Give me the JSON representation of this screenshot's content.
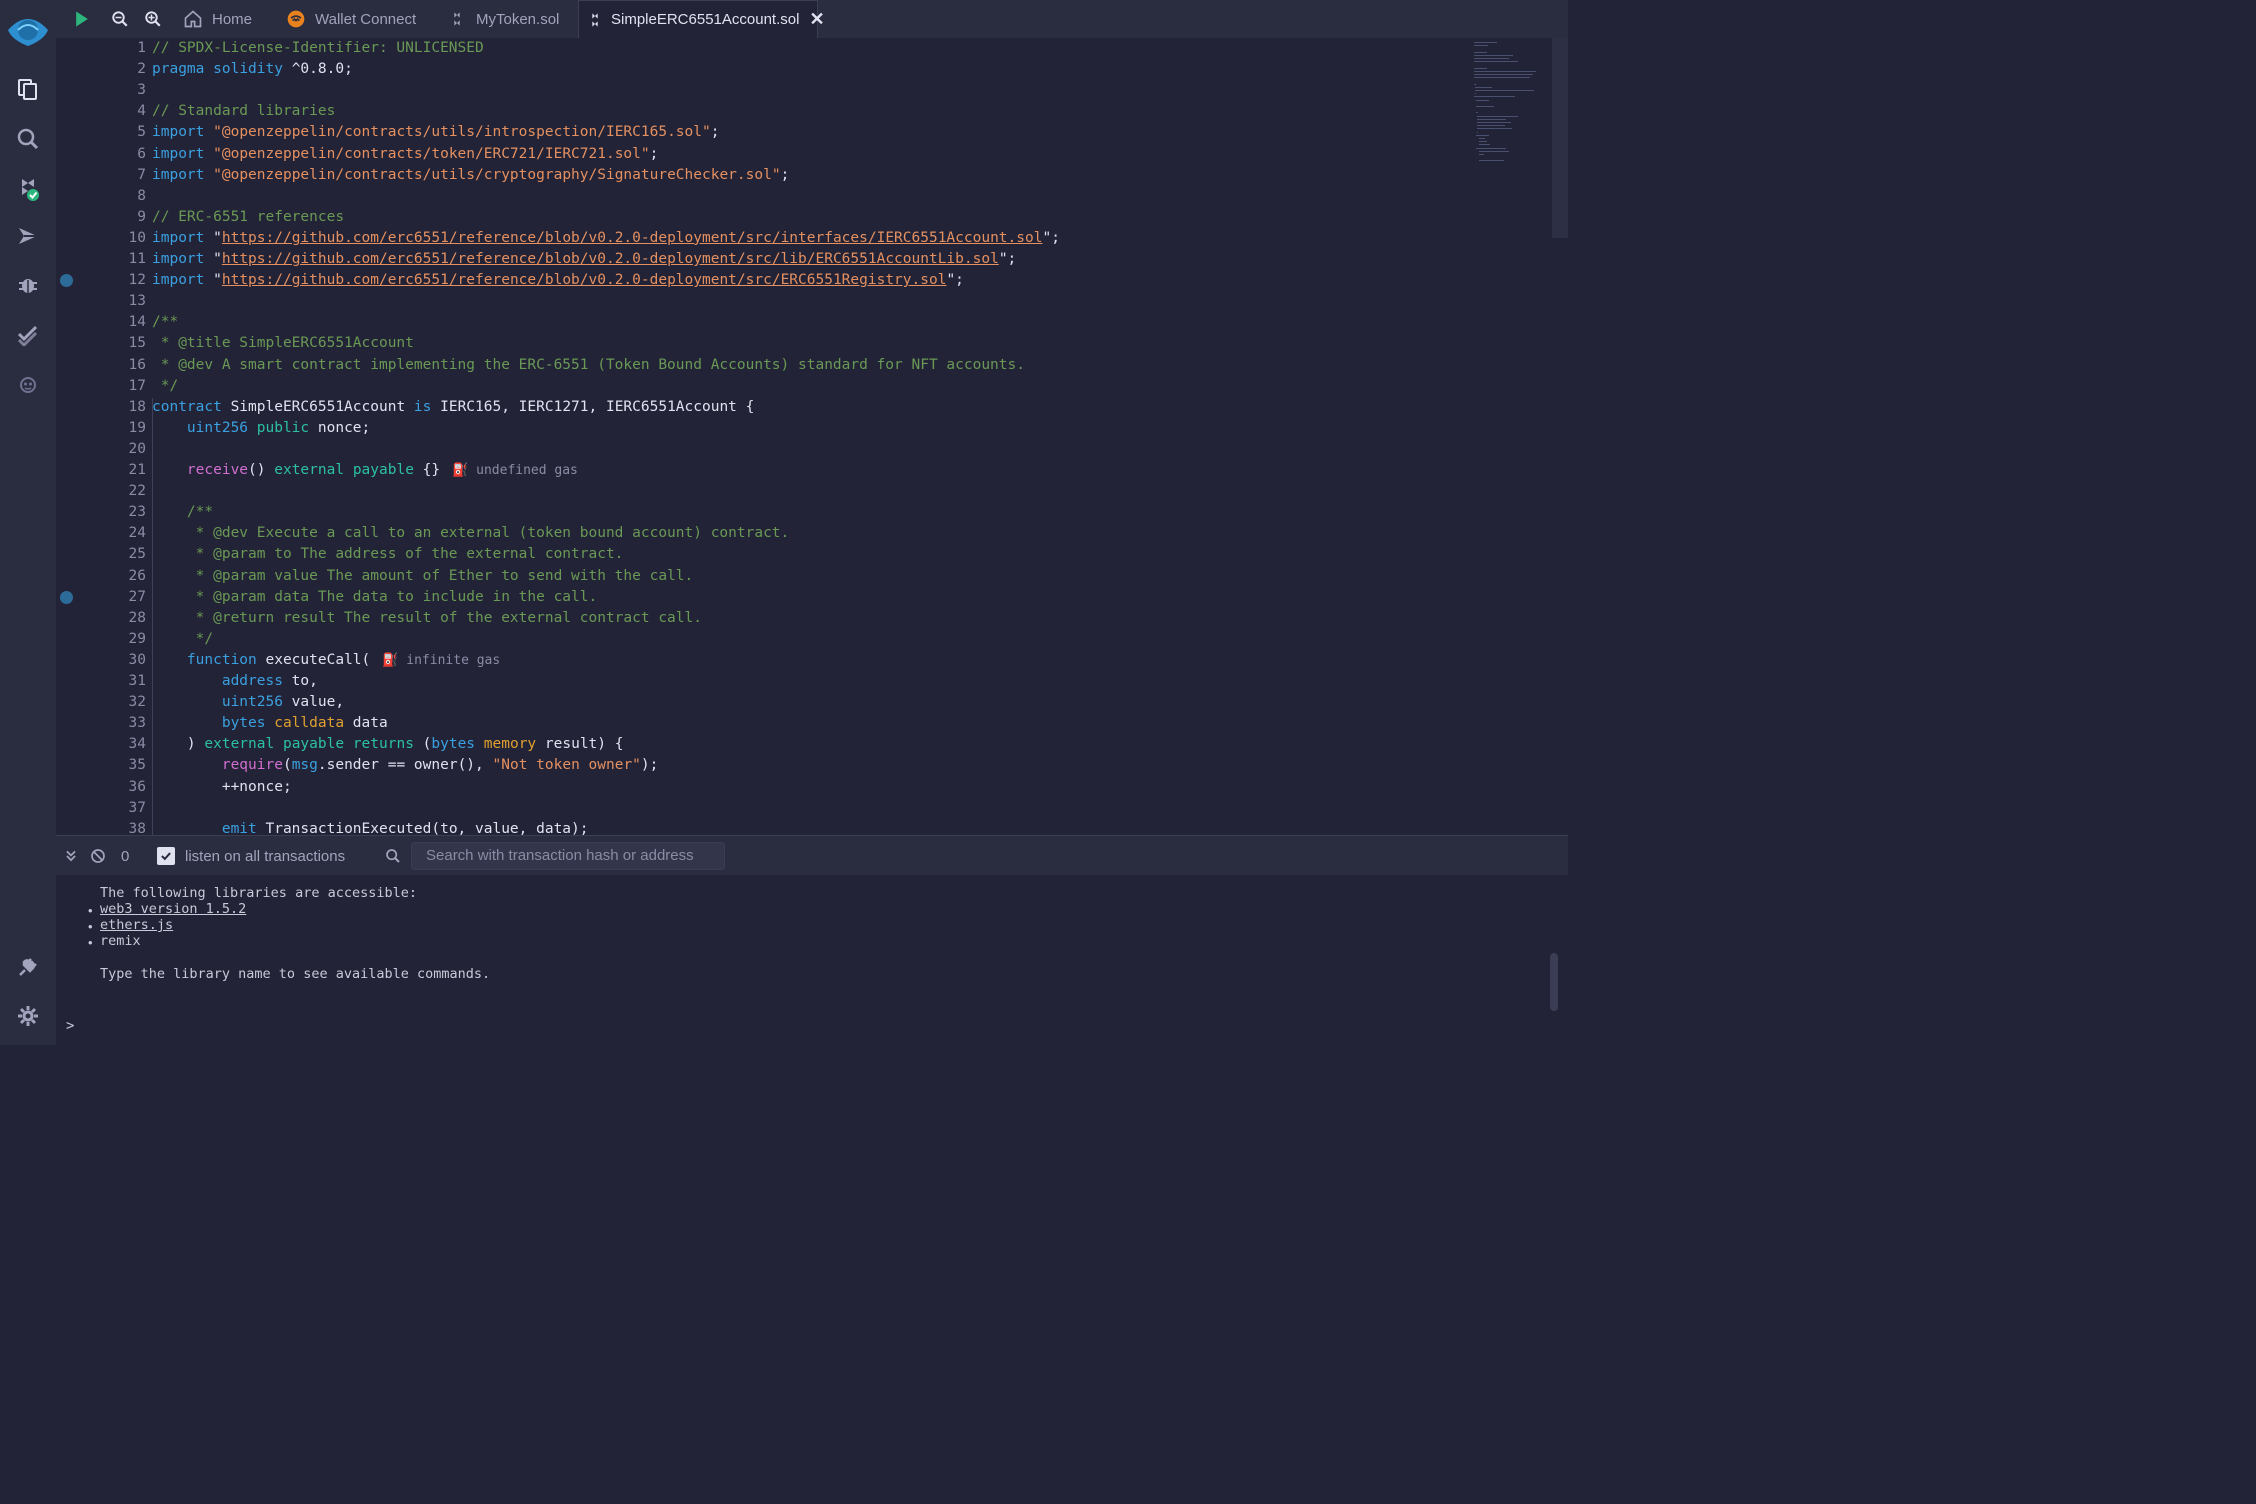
{
  "rail": {
    "icons": [
      "remix-logo-icon",
      "file-explorer-icon",
      "search-icon",
      "solidity-compiler-icon",
      "deploy-run-icon",
      "debugger-icon",
      "solidity-unit-testing-icon",
      "remixai-icon",
      "plugin-manager-icon",
      "settings-icon"
    ]
  },
  "tabbar": {
    "tabs": [
      {
        "label": "Home",
        "icon": "home-icon"
      },
      {
        "label": "Wallet Connect",
        "icon": "walletconnect-icon"
      },
      {
        "label": "MyToken.sol",
        "icon": "solidity-icon"
      },
      {
        "label": "SimpleERC6551Account.sol",
        "icon": "solidity-icon",
        "active": true
      }
    ],
    "close_label": "✕"
  },
  "editor": {
    "line_numbers": [
      "1",
      "2",
      "3",
      "4",
      "5",
      "6",
      "7",
      "8",
      "9",
      "10",
      "11",
      "12",
      "13",
      "14",
      "15",
      "16",
      "17",
      "18",
      "19",
      "20",
      "21",
      "22",
      "23",
      "24",
      "25",
      "26",
      "27",
      "28",
      "29",
      "30",
      "31",
      "32",
      "33",
      "34",
      "35",
      "36",
      "37",
      "38"
    ],
    "breakpoint_lines": [
      12,
      27
    ],
    "lines": [
      "// SPDX-License-Identifier: UNLICENSED",
      "pragma solidity ^0.8.0;",
      "",
      "// Standard libraries",
      "import \"@openzeppelin/contracts/utils/introspection/IERC165.sol\";",
      "import \"@openzeppelin/contracts/token/ERC721/IERC721.sol\";",
      "import \"@openzeppelin/contracts/utils/cryptography/SignatureChecker.sol\";",
      "",
      "// ERC-6551 references",
      "import \"https://github.com/erc6551/reference/blob/v0.2.0-deployment/src/interfaces/IERC6551Account.sol\";",
      "import \"https://github.com/erc6551/reference/blob/v0.2.0-deployment/src/lib/ERC6551AccountLib.sol\";",
      "import \"https://github.com/erc6551/reference/blob/v0.2.0-deployment/src/ERC6551Registry.sol\";",
      "",
      "/**",
      " * @title SimpleERC6551Account",
      " * @dev A smart contract implementing the ERC-6551 (Token Bound Accounts) standard for NFT accounts.",
      " */",
      "contract SimpleERC6551Account is IERC165, IERC1271, IERC6551Account {",
      "    uint256 public nonce;",
      "",
      "    receive() external payable {}",
      "",
      "    /**",
      "     * @dev Execute a call to an external (token bound account) contract.",
      "     * @param to The address of the external contract.",
      "     * @param value The amount of Ether to send with the call.",
      "     * @param data The data to include in the call.",
      "     * @return result The result of the external contract call.",
      "     */",
      "    function executeCall(",
      "        address to,",
      "        uint256 value,",
      "        bytes calldata data",
      "    ) external payable returns (bytes memory result) {",
      "        require(msg.sender == owner(), \"Not token owner\");",
      "        ++nonce;",
      "",
      "        emit TransactionExecuted(to, value, data);"
    ],
    "gas_hints": {
      "line21": "undefined gas",
      "line30": "infinite gas"
    }
  },
  "terminal": {
    "count": "0",
    "listen_label": "listen on all transactions",
    "listen_checked": true,
    "search_placeholder": "Search with transaction hash or address",
    "intro": "The following libraries are accessible:",
    "libraries": [
      "web3 version 1.5.2",
      "ethers.js",
      "remix"
    ],
    "hint": "Type the library name to see available commands.",
    "prompt": ">"
  },
  "colors": {
    "background": "#222336",
    "panel": "#2a2c3f",
    "keyword": "#3ba0e0",
    "comment": "#6a9955",
    "string": "#e59060",
    "accent_green": "#2cc0a0"
  }
}
